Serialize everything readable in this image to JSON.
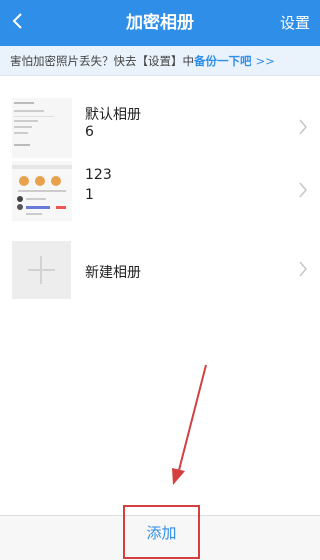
{
  "navbar": {
    "title": "加密相册",
    "right_label": "设置",
    "color": "#2f8ee8"
  },
  "tip": {
    "text": "害怕加密照片丢失？快去【设置】中",
    "link_text": "备份一下吧",
    "arrow": ">>"
  },
  "albums": [
    {
      "name": "默认相册",
      "count": "6"
    },
    {
      "name": "123",
      "count": "1"
    }
  ],
  "new_album_label": "新建相册",
  "footer": {
    "add_label": "添加"
  },
  "annotation": {
    "color": "#d24040"
  }
}
